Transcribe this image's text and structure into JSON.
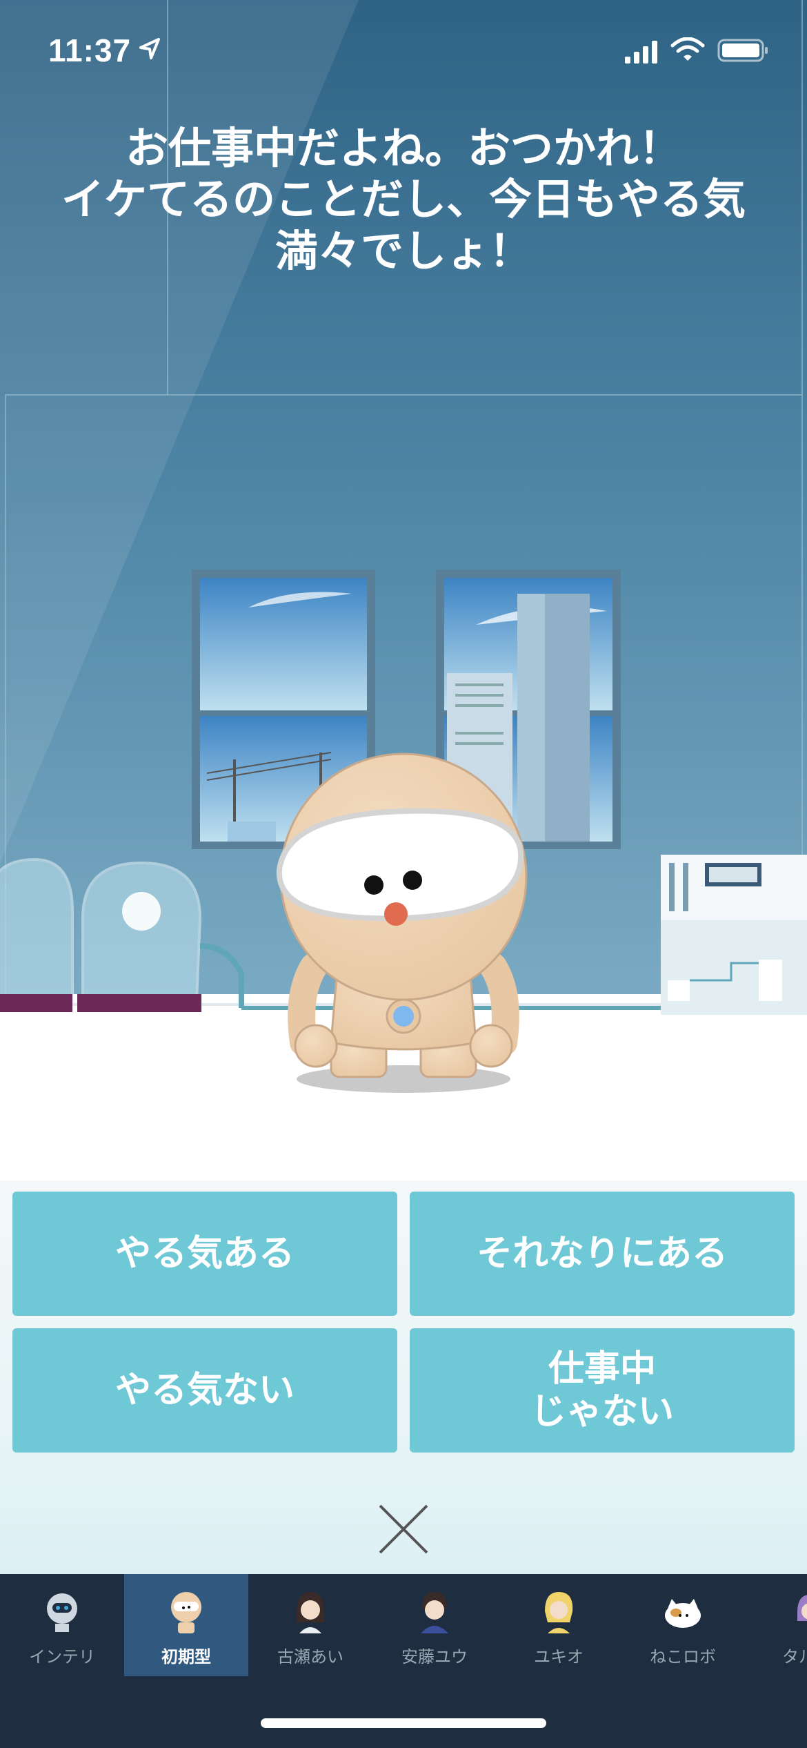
{
  "status_bar": {
    "time": "11:37"
  },
  "message": {
    "lines": [
      "お仕事中だよね。おつかれ！",
      "イケてるのことだし、今日もやる気",
      "満々でしょ！"
    ]
  },
  "answers": {
    "a1": "やる気ある",
    "a2": "それなりにある",
    "a3": "やる気ない",
    "a4": "仕事中\nじゃない"
  },
  "tabs": [
    {
      "label": "インテリ",
      "icon": "robot-avatar-icon",
      "selected": false
    },
    {
      "label": "初期型",
      "icon": "doll-robot-avatar-icon",
      "selected": true
    },
    {
      "label": "古瀬あい",
      "icon": "girl-avatar-icon",
      "selected": false
    },
    {
      "label": "安藤ユウ",
      "icon": "boy-avatar-icon",
      "selected": false
    },
    {
      "label": "ユキオ",
      "icon": "blonde-avatar-icon",
      "selected": false
    },
    {
      "label": "ねこロボ",
      "icon": "cat-robot-avatar-icon",
      "selected": false
    },
    {
      "label": "タルる",
      "icon": "partial-avatar-icon",
      "selected": false
    }
  ],
  "colors": {
    "answer_button": "#6ec8d6",
    "tab_bar": "#1e2d40",
    "tab_selected": "#31597f",
    "room_wall": "#4f86a6"
  }
}
